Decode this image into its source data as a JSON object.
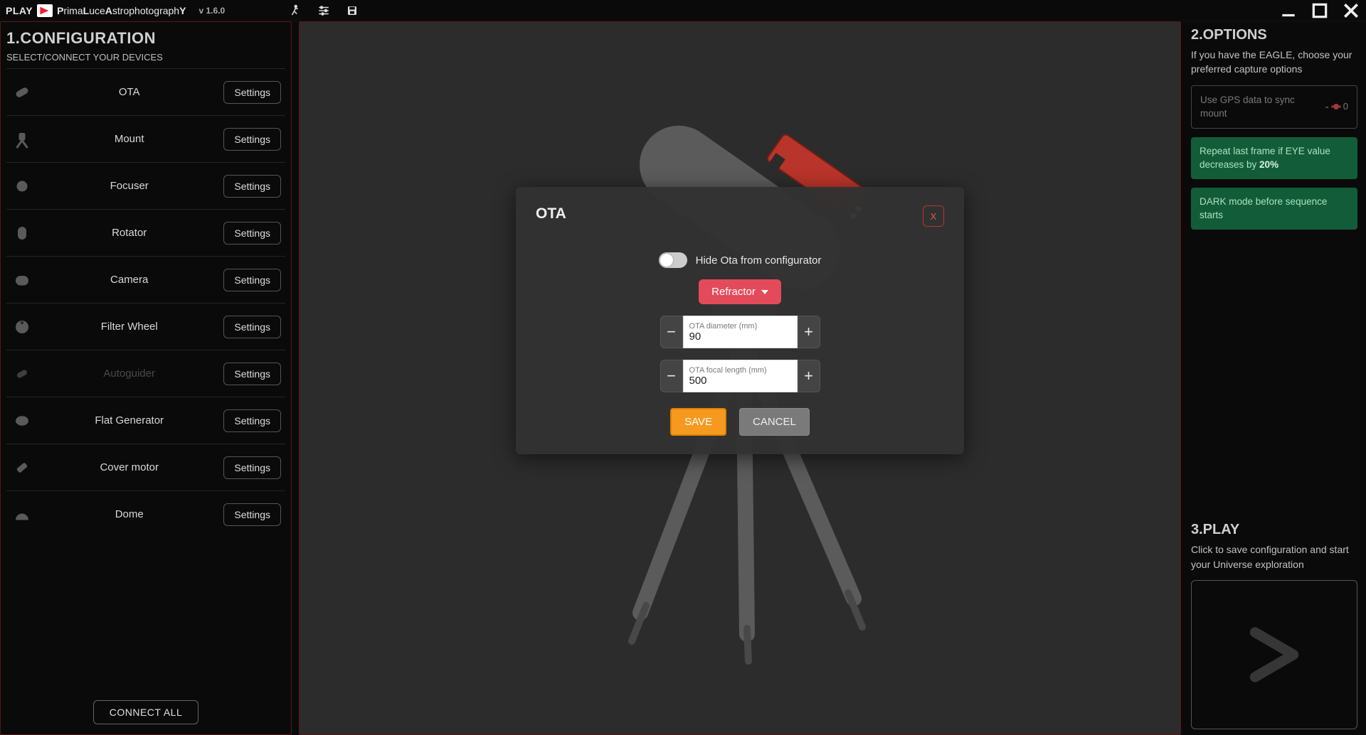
{
  "titlebar": {
    "play": "PLAY",
    "brand_parts": [
      "P",
      "rima",
      "L",
      "uce",
      "A",
      "strophotograph",
      "Y"
    ],
    "brand_html": "PrimaLuceAstrophotographY",
    "version": "v 1.6.0"
  },
  "left": {
    "heading": "1.CONFIGURATION",
    "sub": "SELECT/CONNECT YOUR DEVICES",
    "settings_label": "Settings",
    "connect_all": "CONNECT ALL",
    "devices": [
      {
        "key": "ota",
        "label": "OTA",
        "disabled": false
      },
      {
        "key": "mount",
        "label": "Mount",
        "disabled": false
      },
      {
        "key": "focuser",
        "label": "Focuser",
        "disabled": false
      },
      {
        "key": "rotator",
        "label": "Rotator",
        "disabled": false
      },
      {
        "key": "camera",
        "label": "Camera",
        "disabled": false
      },
      {
        "key": "filterwheel",
        "label": "Filter Wheel",
        "disabled": false
      },
      {
        "key": "autoguider",
        "label": "Autoguider",
        "disabled": true
      },
      {
        "key": "flatgen",
        "label": "Flat Generator",
        "disabled": false
      },
      {
        "key": "covermotor",
        "label": "Cover motor",
        "disabled": false
      },
      {
        "key": "dome",
        "label": "Dome",
        "disabled": false
      }
    ]
  },
  "dialog": {
    "title": "OTA",
    "close": "X",
    "hide_label": "Hide Ota from configurator",
    "type_label": "Refractor",
    "fields": {
      "diameter": {
        "label": "OTA diameter (mm)",
        "value": "90"
      },
      "focal": {
        "label": "OTA focal length (mm)",
        "value": "500"
      }
    },
    "save": "SAVE",
    "cancel": "CANCEL"
  },
  "options": {
    "heading": "2.OPTIONS",
    "sub": "If you have the EAGLE, choose your preferred capture options",
    "gps": {
      "label": "Use GPS data to sync mount",
      "dash": "-",
      "count": "0"
    },
    "repeat_prefix": "Repeat last frame if EYE value decreases by ",
    "repeat_value": "20%",
    "dark": "DARK mode before sequence starts"
  },
  "play": {
    "heading": "3.PLAY",
    "sub": "Click to save configuration and start your Universe exploration"
  }
}
